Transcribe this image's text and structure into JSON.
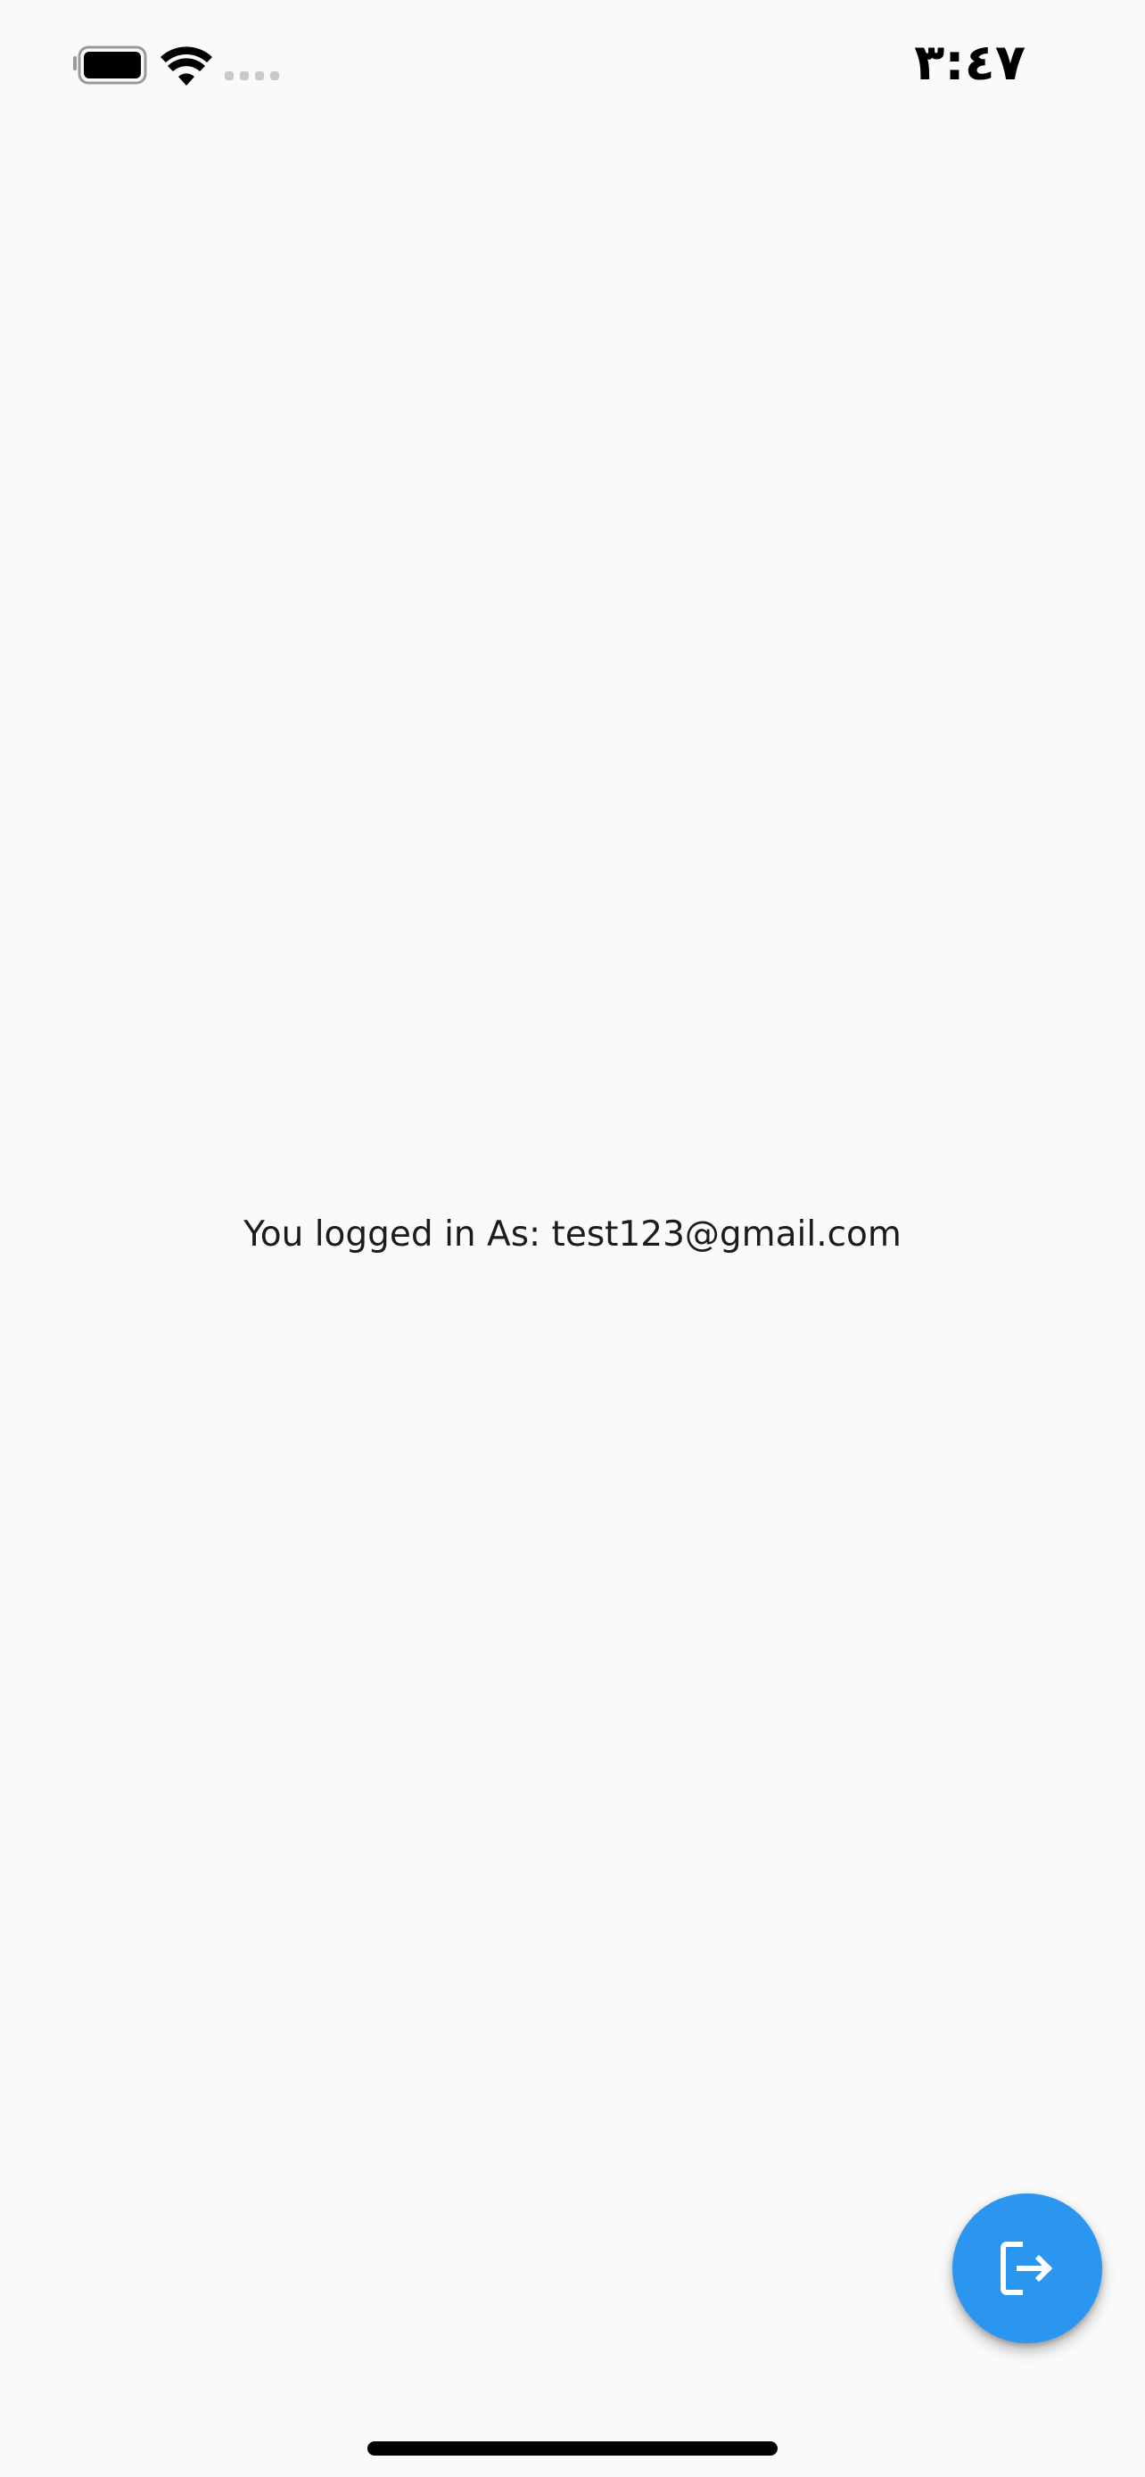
{
  "status_bar": {
    "time": "٣:٤٧",
    "battery_icon": "battery-icon",
    "wifi_icon": "wifi-icon",
    "signal_icon": "cellular-signal-icon"
  },
  "main": {
    "message": "You logged in As: test123@gmail.com"
  },
  "fab": {
    "icon": "logout-icon",
    "color": "#2a96f0"
  }
}
